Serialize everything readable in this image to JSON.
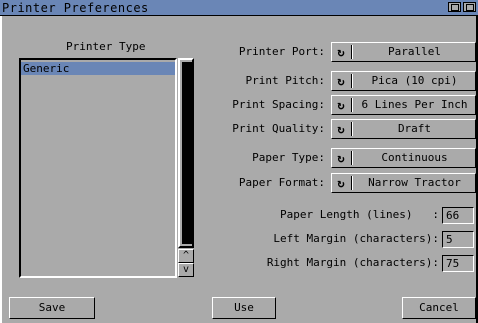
{
  "window": {
    "title": "Printer Preferences"
  },
  "printer_type": {
    "heading": "Printer Type",
    "items": [
      "Generic"
    ],
    "selected_index": 0,
    "scroll_up": "^",
    "scroll_down": "v"
  },
  "settings": [
    {
      "label": "Printer Port:",
      "value": "Parallel"
    },
    {
      "label": "Print Pitch:",
      "value": "Pica (10 cpi)"
    },
    {
      "label": "Print Spacing:",
      "value": "6 Lines Per Inch"
    },
    {
      "label": "Print Quality:",
      "value": "Draft"
    },
    {
      "label": "Paper Type:",
      "value": "Continuous"
    },
    {
      "label": "Paper Format:",
      "value": "Narrow Tractor"
    }
  ],
  "cycle_icon": "cycle-icon",
  "numeric": [
    {
      "label": "Paper Length (lines)   :",
      "value": "66"
    },
    {
      "label": "Left Margin (characters):",
      "value": "5"
    },
    {
      "label": "Right Margin (characters):",
      "value": "75"
    }
  ],
  "buttons": {
    "save": "Save",
    "use": "Use",
    "cancel": "Cancel"
  },
  "colors": {
    "accent": "#6a86b6",
    "background": "#aaaaaa"
  }
}
